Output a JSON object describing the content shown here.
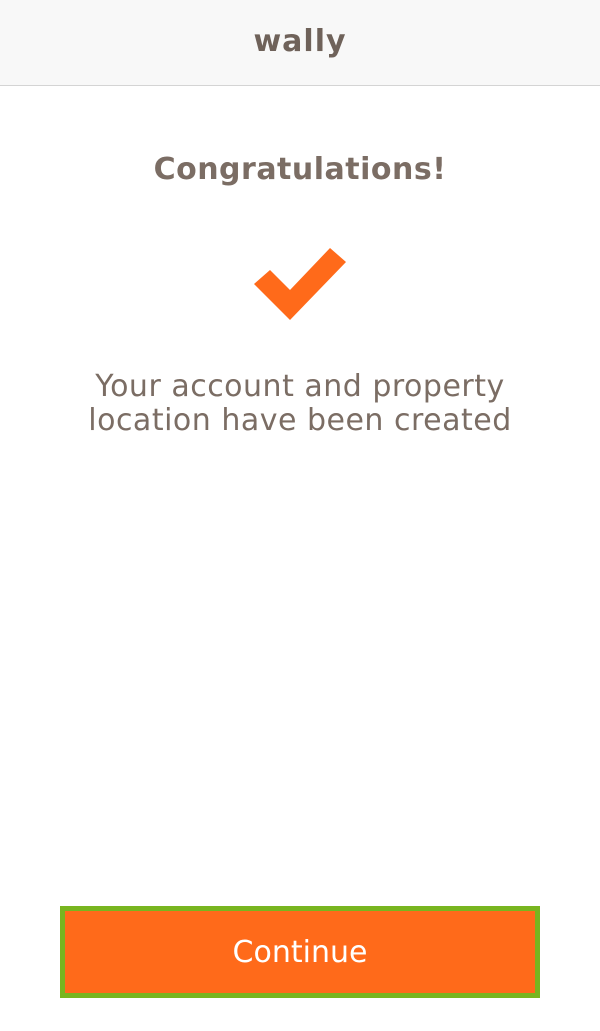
{
  "header": {
    "brand": "wally"
  },
  "main": {
    "title": "Congratulations!",
    "icon": "checkmark-icon",
    "message_line_1": "Your account and property",
    "message_line_2": "location have been created"
  },
  "actions": {
    "continue_label": "Continue"
  },
  "colors": {
    "accent": "#ff6a1a",
    "focus_border": "#78b51f",
    "text": "#7b6d64",
    "header_bg": "#f8f8f8"
  }
}
